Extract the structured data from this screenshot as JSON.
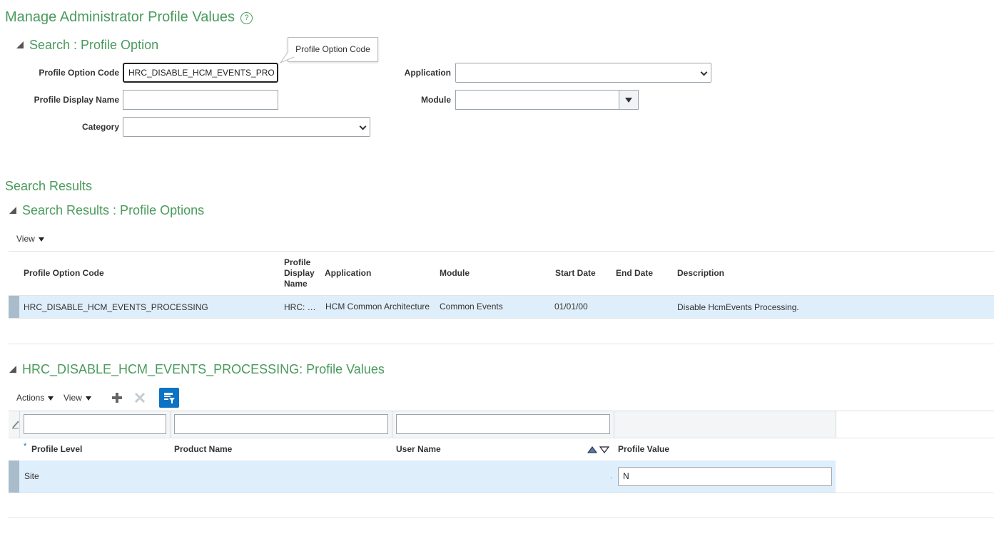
{
  "page": {
    "title": "Manage Administrator Profile Values",
    "help_icon": "?"
  },
  "search": {
    "heading": "Search : Profile Option",
    "tooltip": "Profile Option Code",
    "fields": {
      "profile_option_code": {
        "label": "Profile Option Code",
        "value": "HRC_DISABLE_HCM_EVENTS_PRO"
      },
      "profile_display_name": {
        "label": "Profile Display Name",
        "value": ""
      },
      "category": {
        "label": "Category",
        "value": ""
      },
      "application": {
        "label": "Application",
        "value": ""
      },
      "module": {
        "label": "Module",
        "value": ""
      }
    }
  },
  "results": {
    "heading": "Search Results",
    "subheading": "Search Results : Profile Options",
    "view_label": "View",
    "columns": {
      "code": "Profile Option Code",
      "display_name_1": "Profile",
      "display_name_2": "Display",
      "display_name_3": "Name",
      "application": "Application",
      "module": "Module",
      "start_date": "Start Date",
      "end_date": "End Date",
      "description": "Description"
    },
    "rows": [
      {
        "code": "HRC_DISABLE_HCM_EVENTS_PROCESSING",
        "display_name": "HRC: …",
        "application": "HCM Common Architecture",
        "module": "Common Events",
        "start_date": "01/01/00",
        "end_date": "",
        "description": "Disable HcmEvents Processing."
      }
    ]
  },
  "values": {
    "heading": "HRC_DISABLE_HCM_EVENTS_PROCESSING: Profile Values",
    "actions_label": "Actions",
    "view_label": "View",
    "required_mark": "*",
    "columns": {
      "level": "Profile Level",
      "product": "Product Name",
      "user": "User Name",
      "value": "Profile Value"
    },
    "filters": {
      "level": "",
      "product": "",
      "user": ""
    },
    "rows": [
      {
        "level": "Site",
        "product": "",
        "user": "",
        "dot": ".",
        "value": "N"
      }
    ]
  },
  "colors": {
    "accent_green": "#4a9a5c",
    "selected_row": "#dfeefb",
    "row_indicator": "#a9bccb",
    "toolbar_blue": "#0b72c4"
  }
}
